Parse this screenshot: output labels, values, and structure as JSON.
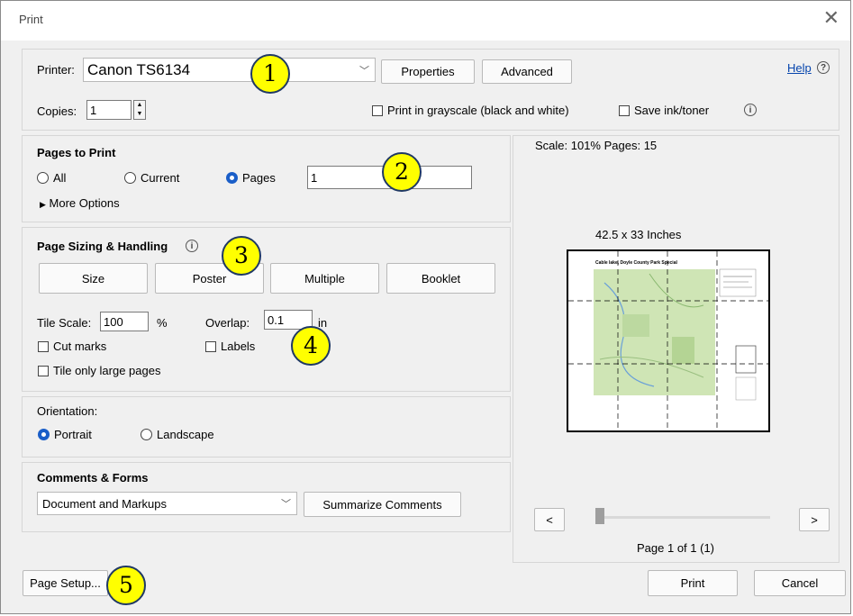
{
  "window": {
    "title": "Print"
  },
  "printer": {
    "label": "Printer:",
    "name": "Canon TS6134",
    "properties": "Properties",
    "advanced": "Advanced",
    "help": "Help",
    "copies_label": "Copies:",
    "copies_value": "1",
    "grayscale": "Print in grayscale (black and white)",
    "save_ink": "Save ink/toner"
  },
  "pages_to_print": {
    "title": "Pages to Print",
    "all": "All",
    "current": "Current",
    "pages": "Pages",
    "pages_value": "1",
    "more": "More Options"
  },
  "sizing": {
    "title": "Page Sizing & Handling",
    "size": "Size",
    "poster": "Poster",
    "multiple": "Multiple",
    "booklet": "Booklet",
    "tile_scale_label": "Tile Scale:",
    "tile_scale_value": "100",
    "percent": "%",
    "overlap_label": "Overlap:",
    "overlap_value": "0.1",
    "overlap_unit": "in",
    "cut_marks": "Cut marks",
    "labels": "Labels",
    "tile_large": "Tile only large pages"
  },
  "orientation": {
    "title": "Orientation:",
    "portrait": "Portrait",
    "landscape": "Landscape"
  },
  "comments": {
    "title": "Comments & Forms",
    "value": "Document and Markups",
    "summarize": "Summarize Comments"
  },
  "preview": {
    "scale_text": "Scale: 101% Pages: 15",
    "dimensions": "42.5 x 33 Inches",
    "map_title": "Cable lake, Doyle County Park Special",
    "page_info": "Page 1 of 1 (1)",
    "prev": "<",
    "next": ">"
  },
  "footer": {
    "page_setup": "Page Setup...",
    "print": "Print",
    "cancel": "Cancel"
  },
  "callouts": [
    "1",
    "2",
    "3",
    "4",
    "5"
  ],
  "colors": {
    "callout_fill": "#ffff00",
    "callout_border": "#1f3864",
    "radio_on": "#1a5ec8",
    "link": "#0645ad"
  }
}
